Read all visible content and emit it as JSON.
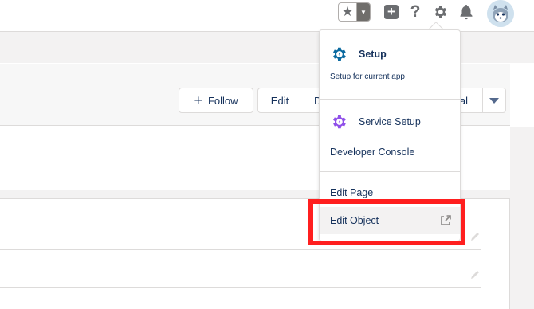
{
  "header": {
    "favorites_icon": "star-icon",
    "favorites_menu_icon": "chevron-down-icon",
    "add_icon": "plus-icon",
    "help_icon": "question-icon",
    "setup_icon": "gear-icon",
    "notifications_icon": "bell-icon",
    "avatar_icon": "astro-avatar"
  },
  "actions": {
    "follow_label": "Follow",
    "edit_label": "Edit",
    "truncated_label_left": "D",
    "truncated_label_right": "al",
    "more_icon": "chevron-down-icon"
  },
  "setup_menu": {
    "setup": {
      "label": "Setup",
      "description": "Setup for current app",
      "icon": "gear-icon"
    },
    "service_setup": {
      "label": "Service Setup",
      "icon": "gear-icon"
    },
    "developer_console": {
      "label": "Developer Console"
    },
    "edit_page": {
      "label": "Edit Page"
    },
    "edit_object": {
      "label": "Edit Object",
      "icon": "external-link-icon"
    }
  },
  "colors": {
    "setup_gear": "#0b6aa0",
    "service_gear": "#9050e9",
    "highlight": "#ff1f1f",
    "icon_gray": "#6b6d70"
  }
}
